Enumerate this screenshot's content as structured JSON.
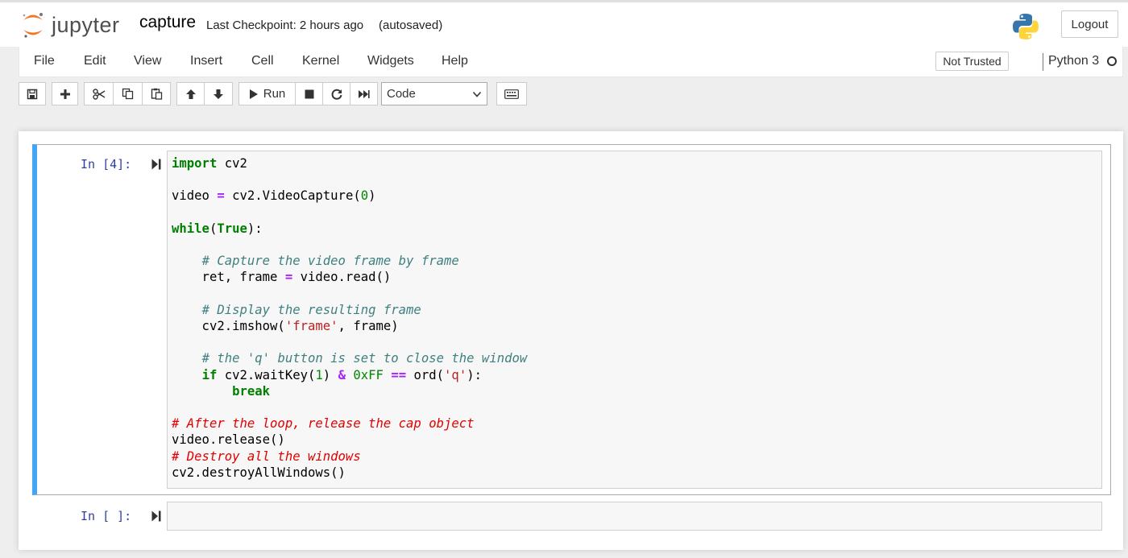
{
  "header": {
    "logo_text": "jupyter",
    "notebook_name": "capture",
    "checkpoint": "Last Checkpoint: 2 hours ago",
    "autosave": "(autosaved)",
    "logout_label": "Logout"
  },
  "menubar": {
    "items": [
      "File",
      "Edit",
      "View",
      "Insert",
      "Cell",
      "Kernel",
      "Widgets",
      "Help"
    ],
    "trust_status": "Not Trusted",
    "kernel_name": "Python 3"
  },
  "toolbar": {
    "run_label": "Run",
    "cell_type": "Code",
    "icons": [
      "save-icon",
      "plus-icon",
      "scissors-icon",
      "copy-icon",
      "paste-icon",
      "arrow-up-icon",
      "arrow-down-icon",
      "play-icon",
      "stop-icon",
      "restart-icon",
      "fast-forward-icon",
      "keyboard-icon"
    ]
  },
  "cells": [
    {
      "prompt": "In [4]:",
      "lines": [
        "import cv2",
        "",
        "video = cv2.VideoCapture(0)",
        "",
        "while(True):",
        "",
        "    # Capture the video frame by frame",
        "    ret, frame = video.read()",
        "",
        "    # Display the resulting frame",
        "    cv2.imshow('frame', frame)",
        "",
        "    # the 'q' button is set to close the window",
        "    if cv2.waitKey(1) & 0xFF == ord('q'):",
        "        break",
        "",
        "# After the loop, release the cap object",
        "video.release()",
        "# Destroy all the windows",
        "cv2.destroyAllWindows()"
      ]
    },
    {
      "prompt": "In [ ]:",
      "lines": []
    }
  ],
  "colors": {
    "selected_cell_bar": "#42a5f5",
    "prompt": "#303f9f",
    "keyword": "#008000",
    "operator": "#aa22ff",
    "string": "#ba2121",
    "comment": "#408080"
  }
}
